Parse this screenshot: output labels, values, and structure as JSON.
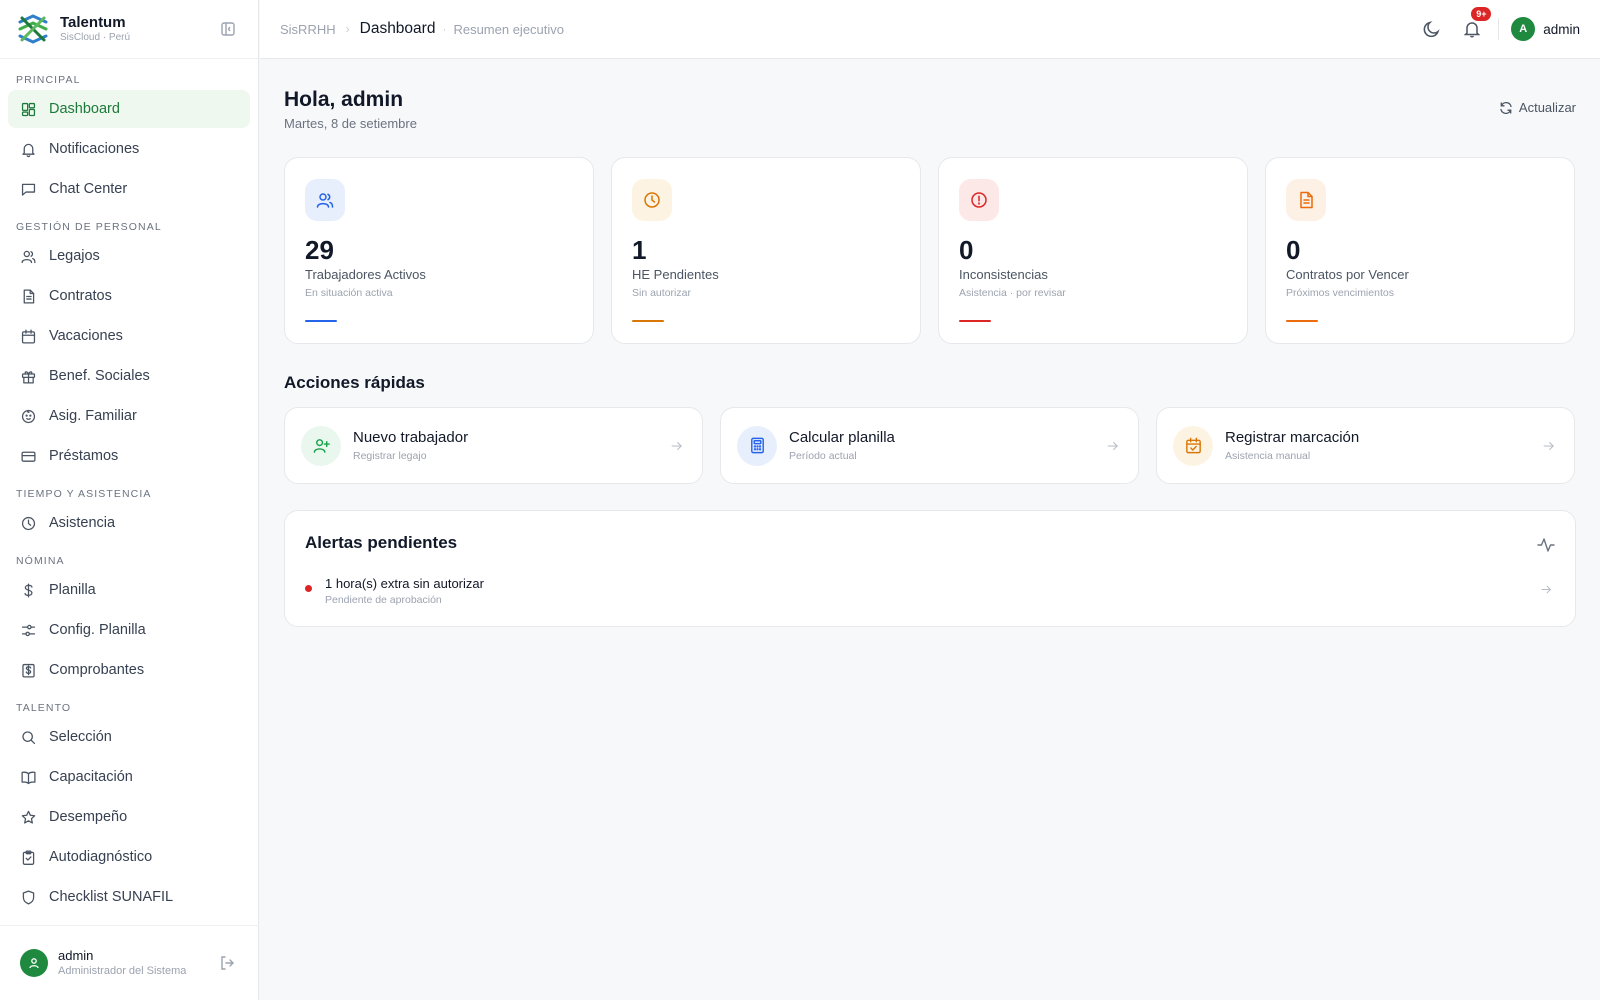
{
  "brand": {
    "name": "Talentum",
    "subtitle": "SisCloud · Perú"
  },
  "breadcrumb": {
    "root": "SisRRHH",
    "current": "Dashboard",
    "description": "Resumen ejecutivo"
  },
  "topbar": {
    "notification_badge": "9+",
    "user_initial": "A",
    "user_name": "admin"
  },
  "sidebar": {
    "sections": [
      {
        "title": "PRINCIPAL",
        "items": [
          {
            "label": "Dashboard",
            "icon": "dashboard-icon",
            "active": true
          },
          {
            "label": "Notificaciones",
            "icon": "bell-icon"
          },
          {
            "label": "Chat Center",
            "icon": "chat-icon"
          }
        ]
      },
      {
        "title": "GESTIÓN DE PERSONAL",
        "items": [
          {
            "label": "Legajos",
            "icon": "users-icon"
          },
          {
            "label": "Contratos",
            "icon": "document-icon"
          },
          {
            "label": "Vacaciones",
            "icon": "calendar-icon"
          },
          {
            "label": "Benef. Sociales",
            "icon": "gift-icon"
          },
          {
            "label": "Asig. Familiar",
            "icon": "baby-icon"
          },
          {
            "label": "Préstamos",
            "icon": "credit-card-icon"
          }
        ]
      },
      {
        "title": "TIEMPO Y ASISTENCIA",
        "items": [
          {
            "label": "Asistencia",
            "icon": "clock-icon"
          }
        ]
      },
      {
        "title": "NÓMINA",
        "items": [
          {
            "label": "Planilla",
            "icon": "dollar-icon"
          },
          {
            "label": "Config. Planilla",
            "icon": "sliders-icon"
          },
          {
            "label": "Comprobantes",
            "icon": "receipt-icon"
          }
        ]
      },
      {
        "title": "TALENTO",
        "items": [
          {
            "label": "Selección",
            "icon": "search-icon"
          },
          {
            "label": "Capacitación",
            "icon": "book-icon"
          },
          {
            "label": "Desempeño",
            "icon": "star-icon"
          },
          {
            "label": "Autodiagnóstico",
            "icon": "clipboard-check-icon"
          },
          {
            "label": "Checklist SUNAFIL",
            "icon": "shield-icon"
          }
        ]
      }
    ],
    "user": {
      "name": "admin",
      "role": "Administrador del Sistema"
    }
  },
  "main": {
    "greeting": "Hola, admin",
    "date": "Martes, 8 de setiembre",
    "refresh_label": "Actualizar",
    "stats": [
      {
        "value": "29",
        "label": "Trabajadores Activos",
        "sub": "En situación activa",
        "color": "#2563eb",
        "bg": "#e8effc",
        "icon": "users-icon"
      },
      {
        "value": "1",
        "label": "HE Pendientes",
        "sub": "Sin autorizar",
        "color": "#d97706",
        "bg": "#fdf3e3",
        "icon": "clock-icon"
      },
      {
        "value": "0",
        "label": "Inconsistencias",
        "sub": "Asistencia · por revisar",
        "color": "#dc2626",
        "bg": "#fde8e8",
        "icon": "alert-circle-icon"
      },
      {
        "value": "0",
        "label": "Contratos por Vencer",
        "sub": "Próximos vencimientos",
        "color": "#ea6c0c",
        "bg": "#fdf0e4",
        "icon": "document-icon"
      }
    ],
    "quick_actions_title": "Acciones rápidas",
    "quick_actions": [
      {
        "title": "Nuevo trabajador",
        "sub": "Registrar legajo",
        "color": "#16a34a",
        "bg": "#eaf7ee",
        "icon": "user-plus-icon"
      },
      {
        "title": "Calcular planilla",
        "sub": "Período actual",
        "color": "#2563eb",
        "bg": "#e8effc",
        "icon": "calculator-icon"
      },
      {
        "title": "Registrar marcación",
        "sub": "Asistencia manual",
        "color": "#d97706",
        "bg": "#fdf3e3",
        "icon": "calendar-check-icon"
      }
    ],
    "alerts": {
      "title": "Alertas pendientes",
      "items": [
        {
          "title": "1 hora(s) extra sin autorizar",
          "sub": "Pendiente de aprobación"
        }
      ]
    }
  }
}
